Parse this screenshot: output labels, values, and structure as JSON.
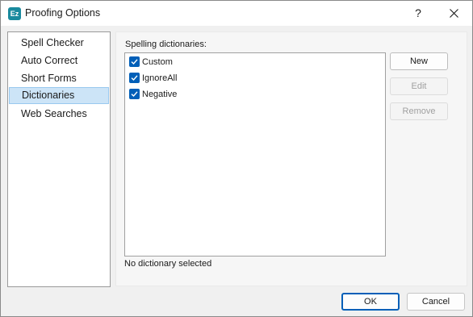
{
  "window": {
    "title": "Proofing Options",
    "app_icon_text": "Ez",
    "help_label": "?"
  },
  "categories": [
    {
      "label": "Spell Checker",
      "selected": false
    },
    {
      "label": "Auto Correct",
      "selected": false
    },
    {
      "label": "Short Forms",
      "selected": false
    },
    {
      "label": "Dictionaries",
      "selected": true
    },
    {
      "label": "Web Searches",
      "selected": false
    }
  ],
  "dictionaries": {
    "group_label": "Spelling dictionaries:",
    "items": [
      {
        "label": "Custom",
        "checked": true
      },
      {
        "label": "IgnoreAll",
        "checked": true
      },
      {
        "label": "Negative",
        "checked": true
      }
    ],
    "status": "No dictionary selected"
  },
  "actions": {
    "new_label": "New",
    "edit_label": "Edit",
    "remove_label": "Remove"
  },
  "footer": {
    "ok_label": "OK",
    "cancel_label": "Cancel"
  },
  "colors": {
    "accent": "#005fb8",
    "selection": "#cce4f7",
    "app_icon": "#1a8a9e"
  }
}
